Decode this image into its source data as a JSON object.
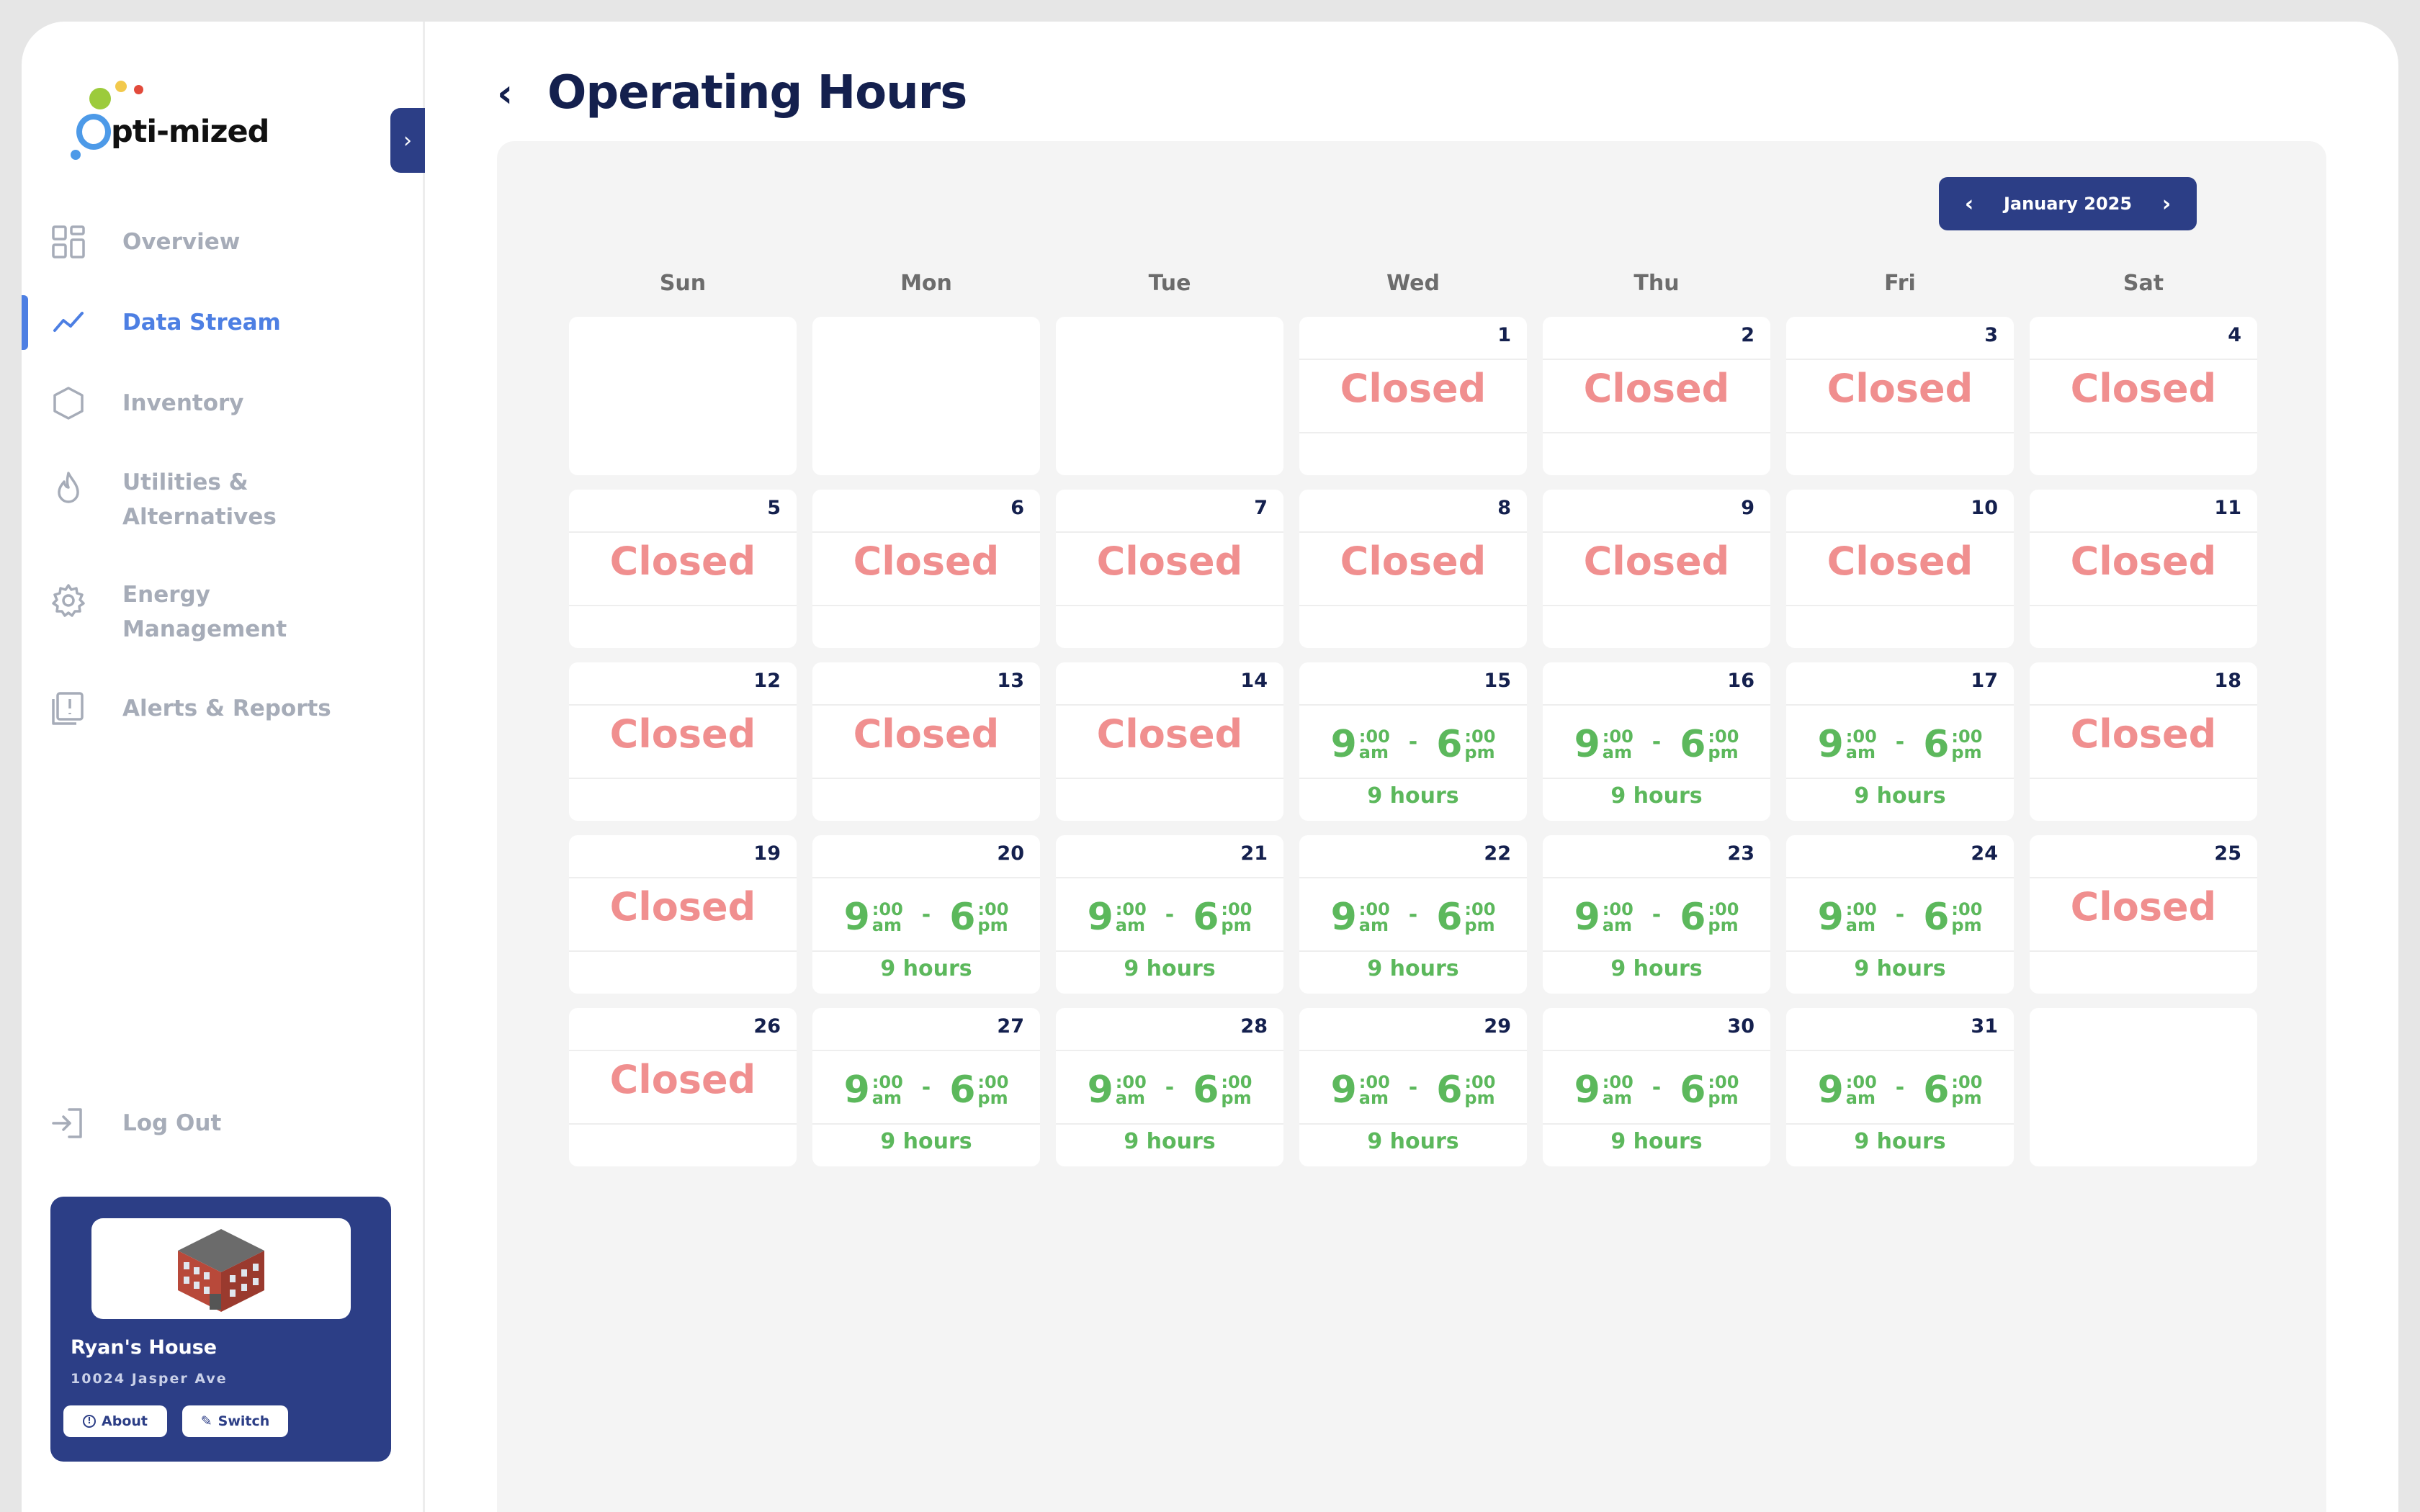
{
  "sidebar": {
    "logo_text": "pti-mized",
    "items": [
      {
        "label": "Overview",
        "icon": "grid-icon"
      },
      {
        "label": "Data Stream",
        "icon": "trend-line-icon",
        "active": true
      },
      {
        "label": "Inventory",
        "icon": "hexagon-icon"
      },
      {
        "label": "Utilities & Alternatives",
        "icon": "flame-icon"
      },
      {
        "label": "Energy Management",
        "icon": "gear-icon"
      },
      {
        "label": "Alerts & Reports",
        "icon": "alert-report-icon"
      }
    ],
    "logout_label": "Log Out",
    "site": {
      "name": "Ryan's House",
      "address": "10024 Jasper Ave",
      "about_label": "About",
      "switch_label": "Switch"
    }
  },
  "header": {
    "title": "Operating Hours"
  },
  "calendar": {
    "month_label": "January 2025",
    "weekdays": [
      "Sun",
      "Mon",
      "Tue",
      "Wed",
      "Thu",
      "Fri",
      "Sat"
    ],
    "closed_label": "Closed",
    "days": [
      {
        "day": "1",
        "status": "closed"
      },
      {
        "day": "2",
        "status": "closed"
      },
      {
        "day": "3",
        "status": "closed"
      },
      {
        "day": "4",
        "status": "closed"
      },
      {
        "day": "5",
        "status": "closed"
      },
      {
        "day": "6",
        "status": "closed"
      },
      {
        "day": "7",
        "status": "closed"
      },
      {
        "day": "8",
        "status": "closed"
      },
      {
        "day": "9",
        "status": "closed"
      },
      {
        "day": "10",
        "status": "closed"
      },
      {
        "day": "11",
        "status": "closed"
      },
      {
        "day": "12",
        "status": "closed"
      },
      {
        "day": "13",
        "status": "closed"
      },
      {
        "day": "14",
        "status": "closed"
      },
      {
        "day": "15",
        "status": "open",
        "open_hour": "9",
        "open_min": ":00",
        "open_ampm": "am",
        "close_hour": "6",
        "close_min": ":00",
        "close_ampm": "pm",
        "duration": "9 hours"
      },
      {
        "day": "16",
        "status": "open",
        "open_hour": "9",
        "open_min": ":00",
        "open_ampm": "am",
        "close_hour": "6",
        "close_min": ":00",
        "close_ampm": "pm",
        "duration": "9 hours"
      },
      {
        "day": "17",
        "status": "open",
        "open_hour": "9",
        "open_min": ":00",
        "open_ampm": "am",
        "close_hour": "6",
        "close_min": ":00",
        "close_ampm": "pm",
        "duration": "9 hours"
      },
      {
        "day": "18",
        "status": "closed"
      },
      {
        "day": "19",
        "status": "closed"
      },
      {
        "day": "20",
        "status": "open",
        "open_hour": "9",
        "open_min": ":00",
        "open_ampm": "am",
        "close_hour": "6",
        "close_min": ":00",
        "close_ampm": "pm",
        "duration": "9 hours"
      },
      {
        "day": "21",
        "status": "open",
        "open_hour": "9",
        "open_min": ":00",
        "open_ampm": "am",
        "close_hour": "6",
        "close_min": ":00",
        "close_ampm": "pm",
        "duration": "9 hours"
      },
      {
        "day": "22",
        "status": "open",
        "open_hour": "9",
        "open_min": ":00",
        "open_ampm": "am",
        "close_hour": "6",
        "close_min": ":00",
        "close_ampm": "pm",
        "duration": "9 hours"
      },
      {
        "day": "23",
        "status": "open",
        "open_hour": "9",
        "open_min": ":00",
        "open_ampm": "am",
        "close_hour": "6",
        "close_min": ":00",
        "close_ampm": "pm",
        "duration": "9 hours"
      },
      {
        "day": "24",
        "status": "open",
        "open_hour": "9",
        "open_min": ":00",
        "open_ampm": "am",
        "close_hour": "6",
        "close_min": ":00",
        "close_ampm": "pm",
        "duration": "9 hours"
      },
      {
        "day": "25",
        "status": "closed"
      },
      {
        "day": "26",
        "status": "closed"
      },
      {
        "day": "27",
        "status": "open",
        "open_hour": "9",
        "open_min": ":00",
        "open_ampm": "am",
        "close_hour": "6",
        "close_min": ":00",
        "close_ampm": "pm",
        "duration": "9 hours"
      },
      {
        "day": "28",
        "status": "open",
        "open_hour": "9",
        "open_min": ":00",
        "open_ampm": "am",
        "close_hour": "6",
        "close_min": ":00",
        "close_ampm": "pm",
        "duration": "9 hours"
      },
      {
        "day": "29",
        "status": "open",
        "open_hour": "9",
        "open_min": ":00",
        "open_ampm": "am",
        "close_hour": "6",
        "close_min": ":00",
        "close_ampm": "pm",
        "duration": "9 hours"
      },
      {
        "day": "30",
        "status": "open",
        "open_hour": "9",
        "open_min": ":00",
        "open_ampm": "am",
        "close_hour": "6",
        "close_min": ":00",
        "close_ampm": "pm",
        "duration": "9 hours"
      },
      {
        "day": "31",
        "status": "open",
        "open_hour": "9",
        "open_min": ":00",
        "open_ampm": "am",
        "close_hour": "6",
        "close_min": ":00",
        "close_ampm": "pm",
        "duration": "9 hours"
      }
    ]
  },
  "colors": {
    "brand": "#2c3e86",
    "accent": "#4d7fe3",
    "closed": "#f08f8f",
    "open": "#5cb85c",
    "title": "#14204e"
  }
}
